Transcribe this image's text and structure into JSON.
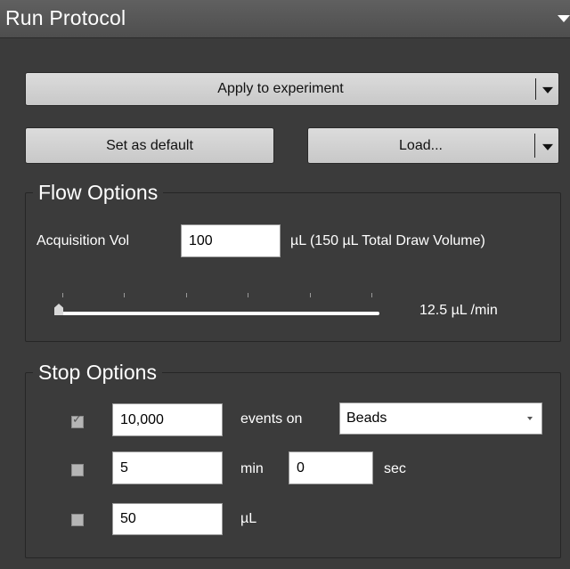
{
  "panel": {
    "title": "Run Protocol"
  },
  "buttons": {
    "apply": "Apply to experiment",
    "set_default": "Set as default",
    "load": "Load..."
  },
  "flow_options": {
    "legend": "Flow Options",
    "acq_label": "Acquisition Vol",
    "acq_value": "100",
    "acq_suffix": "µL (150 µL Total Draw Volume)",
    "flow_rate_text": "12.5 µL /min",
    "slider_fraction": 0.0
  },
  "stop_options": {
    "legend": "Stop Options",
    "rows": [
      {
        "checked": true,
        "value": "10,000",
        "unit": "events on",
        "select_value": "Beads"
      },
      {
        "checked": false,
        "value": "5",
        "unit": "min",
        "sec_value": "0",
        "sec_unit": "sec"
      },
      {
        "checked": false,
        "value": "50",
        "unit": "µL"
      }
    ]
  },
  "colors": {
    "panel_bg": "#3b3b3b",
    "button_bg": "#d4d4d4",
    "text": "#ffffff"
  }
}
